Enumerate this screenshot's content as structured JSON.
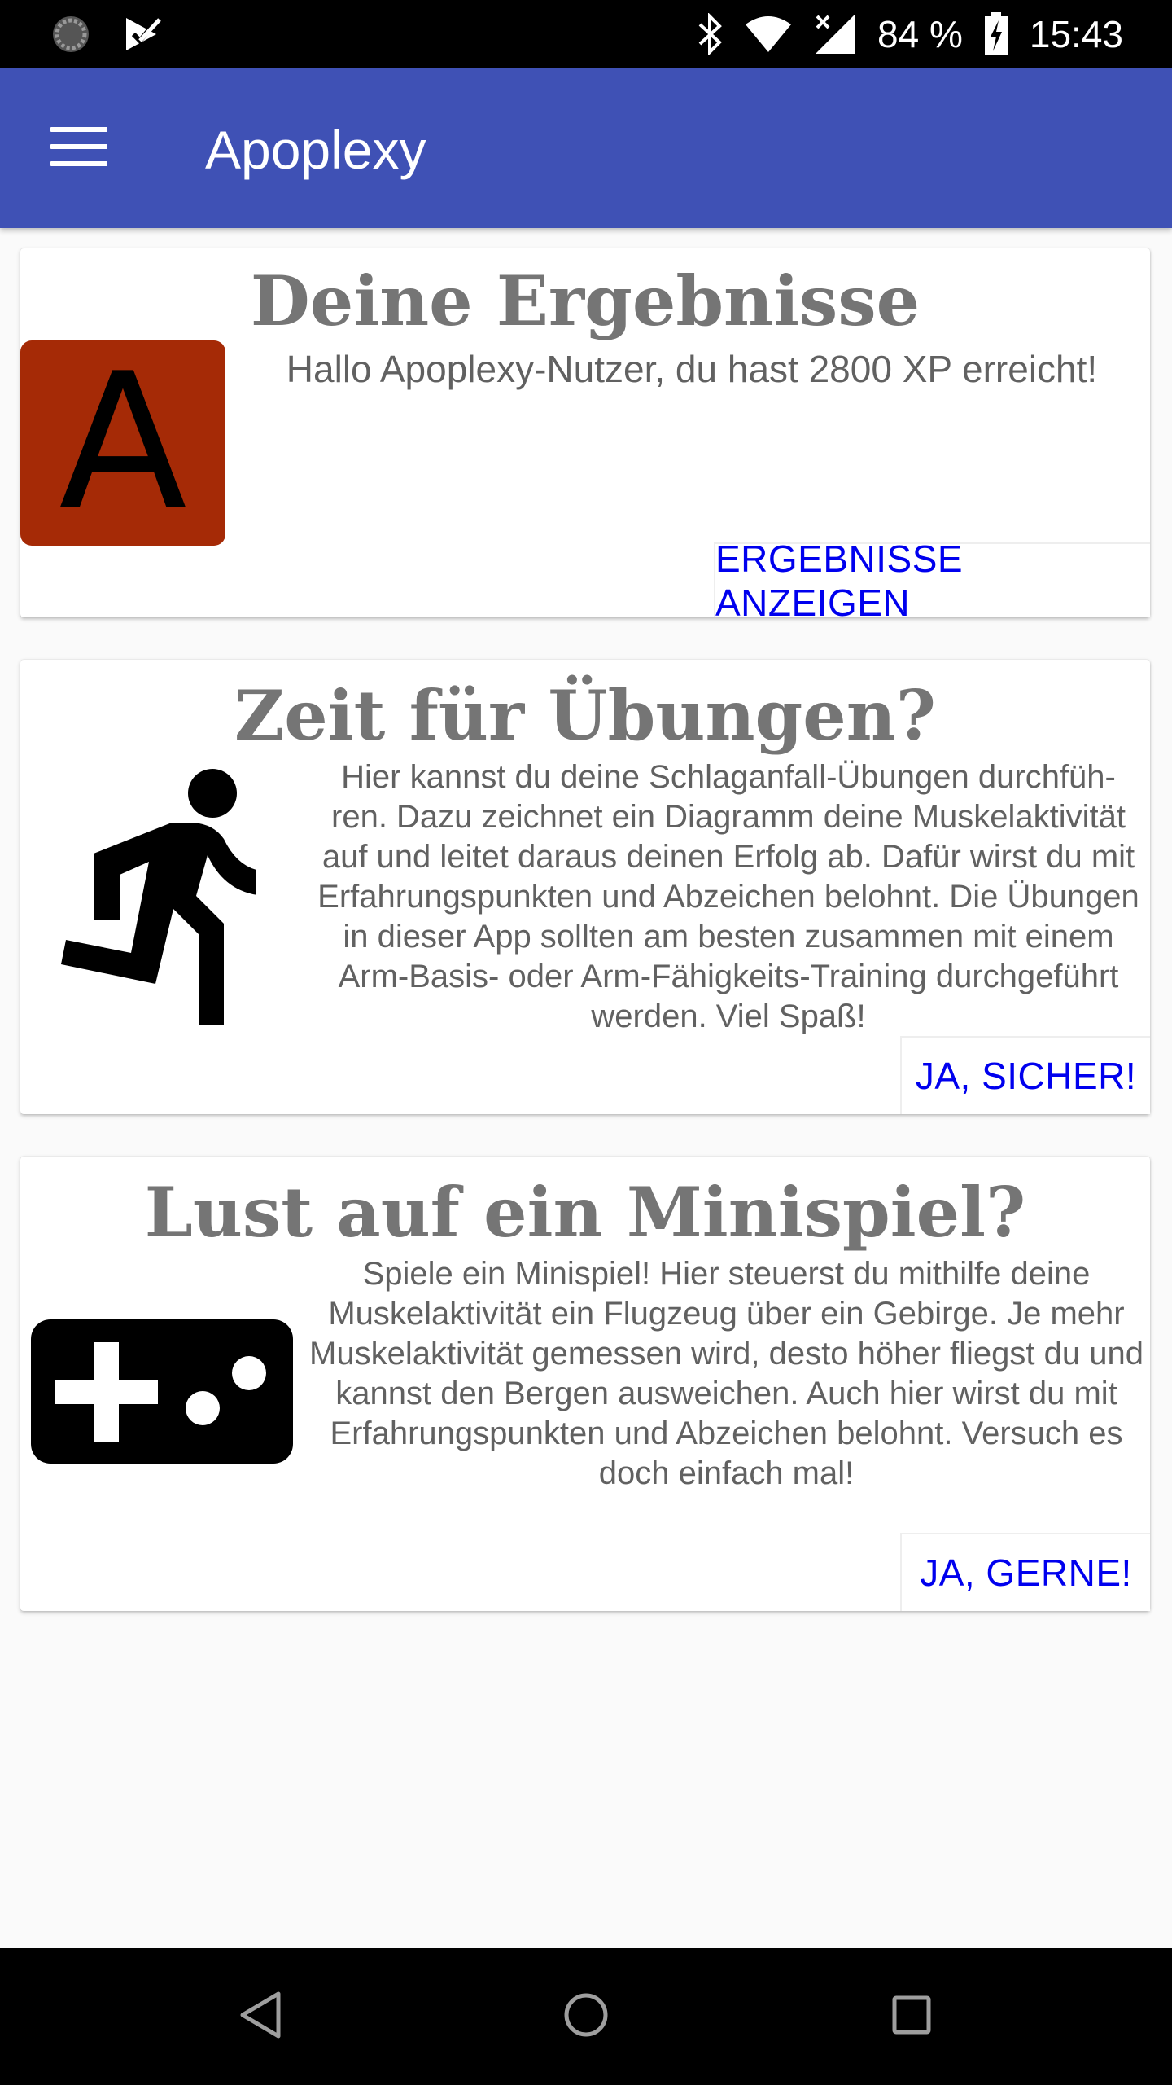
{
  "status_bar": {
    "battery_percent": "84 %",
    "time": "15:43",
    "icons": [
      "sync-icon",
      "check-flag-icon",
      "bluetooth-icon",
      "wifi-icon",
      "signal-icon",
      "battery-icon"
    ]
  },
  "app_bar": {
    "title": "Apoplexy",
    "color": "#3f51b5"
  },
  "cards": {
    "results": {
      "title": "Deine Ergebnisse",
      "avatar_letter": "A",
      "avatar_color": "#a52a06",
      "text": "Hallo Apoplexy-Nutzer, du hast 2800 XP erreicht!",
      "button": "ERGEBNISSE ANZEIGEN"
    },
    "exercises": {
      "title": "Zeit für Übungen?",
      "icon": "running-person-icon",
      "text": "Hier kannst du deine Schlaganfall-Übungen durchfüh-ren. Dazu zeichnet ein Diagramm deine Muskelaktivität auf und leitet daraus deinen Erfolg ab. Dafür wirst du mit Erfahrungspunkten und Abzeichen belohnt. Die Übungen in dieser App sollten am besten zusammen mit einem Arm-Basis- oder Arm-Fähigkeits-Training durchgeführt werden. Viel Spaß!",
      "button": "JA, SICHER!"
    },
    "minigame": {
      "title": "Lust auf ein Minispiel?",
      "icon": "gamepad-icon",
      "text": "Spiele ein Minispiel! Hier steuerst du mithilfe deine Muskelaktivität ein Flugzeug über ein Gebirge. Je mehr Muskelaktivität gemessen wird, desto höher fliegst du und kannst den Bergen ausweichen. Auch hier wirst du mit Erfahrungspunkten und Abzeichen belohnt. Versuch es doch einfach mal!",
      "button": "JA, GERNE!"
    }
  },
  "nav_bar": {
    "buttons": [
      "back-icon",
      "home-icon",
      "recents-icon"
    ]
  },
  "colors": {
    "link": "#0000ee",
    "title_gray": "#757575"
  }
}
